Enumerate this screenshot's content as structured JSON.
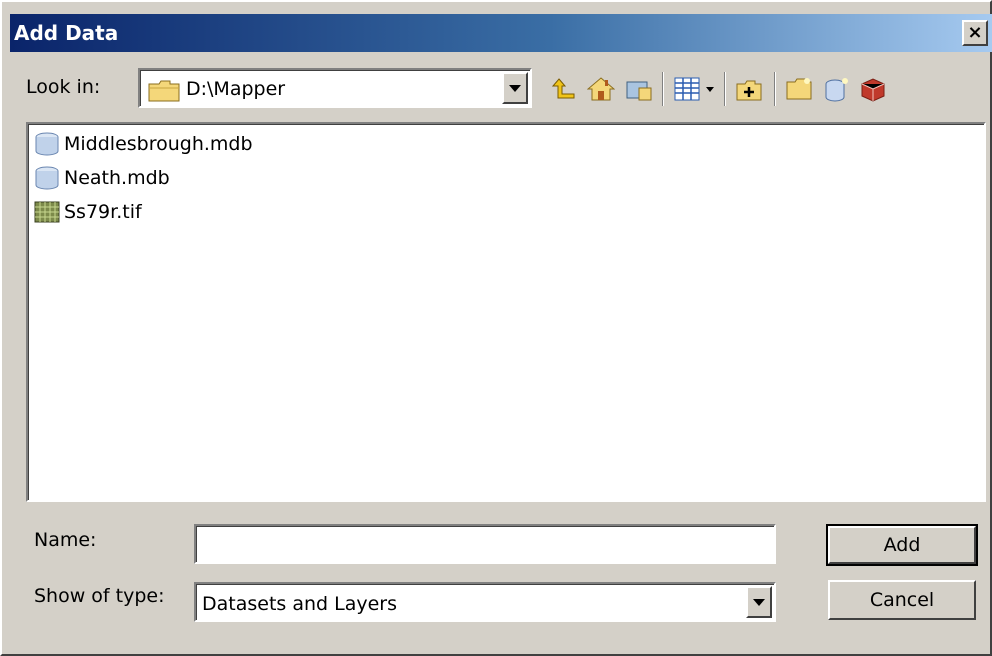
{
  "window": {
    "title": "Add Data",
    "close_label": "×"
  },
  "lookin": {
    "label": "Look in:",
    "value": "D:\\Mapper"
  },
  "toolbar": {
    "buttons": [
      {
        "icon": "up-one-level-icon"
      },
      {
        "icon": "home-icon"
      },
      {
        "icon": "connect-to-folder-icon"
      },
      {
        "icon": "details-view-icon"
      },
      {
        "icon": "view-dropdown-icon"
      },
      {
        "icon": "new-folder-icon"
      },
      {
        "icon": "folder-options-icon"
      },
      {
        "icon": "new-database-icon"
      },
      {
        "icon": "catalog-tools-icon"
      }
    ]
  },
  "files": [
    {
      "name": "Middlesbrough.mdb",
      "icon": "database-icon"
    },
    {
      "name": "Neath.mdb",
      "icon": "database-icon"
    },
    {
      "name": "Ss79r.tif",
      "icon": "raster-icon"
    }
  ],
  "name_field": {
    "label": "Name:",
    "value": ""
  },
  "type_field": {
    "label": "Show of type:",
    "value": "Datasets and Layers"
  },
  "buttons": {
    "add": "Add",
    "cancel": "Cancel"
  },
  "colors": {
    "title_gradient_start": "#0a246a",
    "title_gradient_end": "#a6caf0",
    "dialog_bg": "#d4d0c8"
  }
}
